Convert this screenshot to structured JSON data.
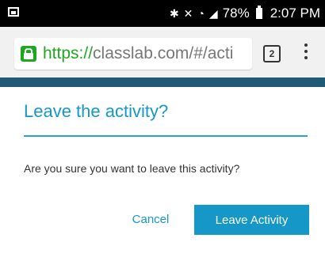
{
  "status_bar": {
    "battery_percent": "78%",
    "time": "2:07 PM",
    "icons": [
      "gallery-icon",
      "bluetooth-icon",
      "mute-icon",
      "wifi-icon",
      "signal-icon",
      "battery-icon"
    ]
  },
  "browser": {
    "url_scheme": "https://",
    "url_rest": "classlab.com/#/acti",
    "tab_count": "2"
  },
  "dialog": {
    "title": "Leave the activity?",
    "message": "Are you sure you want to leave this activity?",
    "cancel_label": "Cancel",
    "confirm_label": "Leave Activity"
  },
  "colors": {
    "accent": "#1598c8",
    "banner": "#1f5b77",
    "secure_green": "#1ea81e"
  }
}
